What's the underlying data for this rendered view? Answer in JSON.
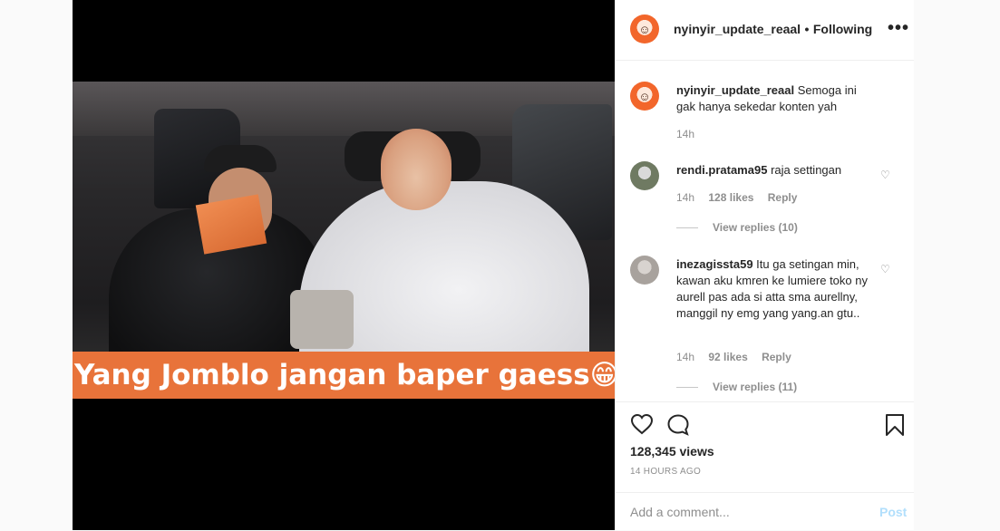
{
  "video": {
    "caption": "Yang Jomblo jangan baper gaess😁😂😂😂"
  },
  "header": {
    "username": "nyinyir_update_reaal",
    "separator": "•",
    "follow_status": "Following",
    "more_glyph": "•••",
    "avatar_icon": "avatar-icon"
  },
  "post_caption": {
    "username": "nyinyir_update_reaal",
    "text": "Semoga ini gak hanya sekedar konten yah",
    "time": "14h"
  },
  "comments": [
    {
      "username": "rendi.pratama95",
      "text": "raja settingan",
      "time": "14h",
      "likes": "128 likes",
      "reply_label": "Reply",
      "view_replies": "View replies (10)"
    },
    {
      "username": "inezagissta59",
      "text": "Itu ga setingan min, kawan aku kmren ke lumiere toko ny aurell pas ada si atta sma aurellny, manggil ny emg yang yang.an gtu..",
      "time": "14h",
      "likes": "92 likes",
      "reply_label": "Reply",
      "view_replies": "View replies (11)"
    }
  ],
  "actions": {
    "views": "128,345 views",
    "time_ago": "14 HOURS AGO"
  },
  "add_comment": {
    "placeholder": "Add a comment...",
    "post_label": "Post"
  }
}
